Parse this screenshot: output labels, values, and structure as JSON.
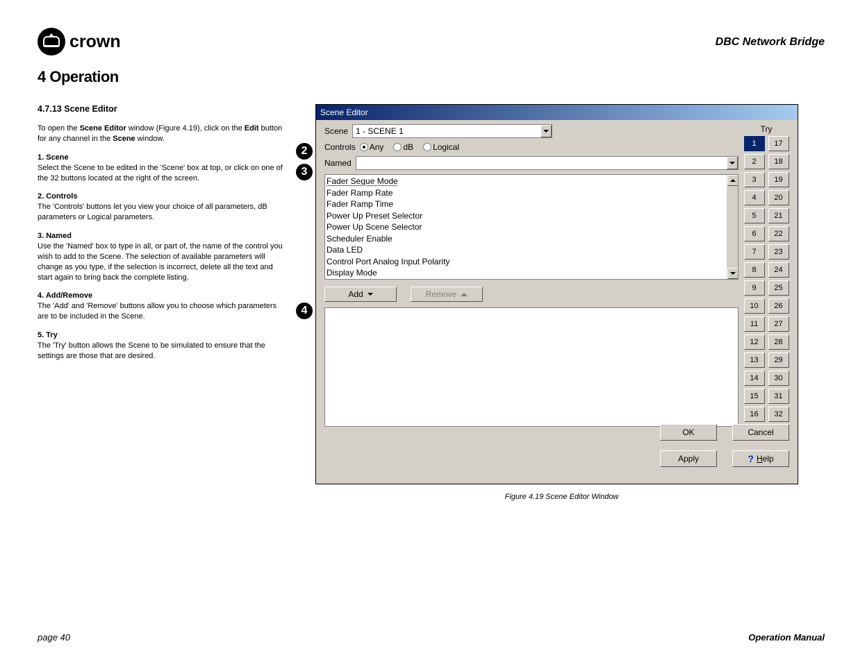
{
  "header": {
    "brand": "crown",
    "doc_title": "DBC Network Bridge"
  },
  "section_title": "4 Operation",
  "sub_title": "4.7.13 Scene Editor",
  "intro_a": "To open the ",
  "intro_b": "Scene Editor",
  "intro_c": " window (Figure 4.19), click on the ",
  "intro_d": "Edit",
  "intro_e": " button for any channel in the ",
  "intro_f": "Scene",
  "intro_g": " window.",
  "steps": {
    "s1": {
      "title": "1. Scene",
      "text": "Select the Scene to be edited in the 'Scene' box at top, or click on one of the 32 buttons located at the right of the screen."
    },
    "s2": {
      "title": "2. Controls",
      "text": "The 'Controls' buttons let you view your choice of all parameters, dB parameters or Logical parameters."
    },
    "s3": {
      "title": "3. Named",
      "text": "Use the 'Named' box to type in all, or part of, the name of the control you wish to add to the Scene. The selection of available parameters will change as you type, if the selection is incorrect, delete all the text and start again to bring back the complete listing."
    },
    "s4": {
      "title": "4. Add/Remove",
      "text": "The 'Add' and 'Remove' buttons allow you to choose which parameters are to be included in the Scene."
    },
    "s5": {
      "title": "5. Try",
      "text": "The 'Try' button allows the Scene to be simulated to ensure that the settings are those that are desired."
    }
  },
  "dialog": {
    "title": "Scene Editor",
    "scene_label": "Scene",
    "scene_value": "1 - SCENE 1",
    "controls_label": "Controls",
    "radio_any": "Any",
    "radio_db": "dB",
    "radio_logical": "Logical",
    "named_label": "Named",
    "list": {
      "i0": "Fader Segue Mode",
      "i1": "Fader Ramp Rate",
      "i2": "Fader Ramp Time",
      "i3": "Power Up Preset Selector",
      "i4": "Power Up Scene Selector",
      "i5": "Scheduler Enable",
      "i6": "Data LED",
      "i7": "Control Port Analog Input Polarity",
      "i8": "Display Mode"
    },
    "add_label": "Add",
    "remove_label": "Remove",
    "ok_label": "OK",
    "cancel_label": "Cancel",
    "apply_label": "Apply",
    "help_label": "elp",
    "help_letter": "H",
    "try_label": "Try"
  },
  "caption": "Figure 4.19  Scene Editor Window",
  "footer": {
    "page": "page 40",
    "manual": "Operation Manual"
  }
}
